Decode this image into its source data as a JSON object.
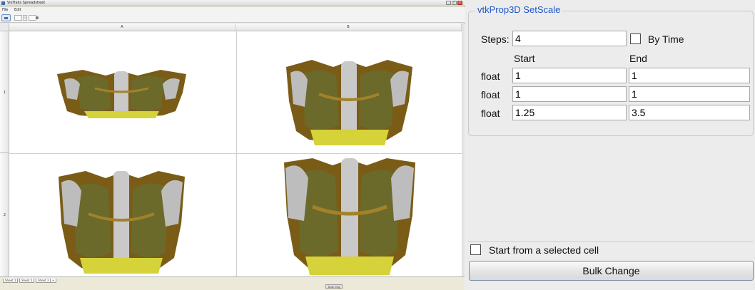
{
  "spreadsheet": {
    "window_title": "VisTrails Spreadsheet",
    "menu": [
      "File",
      "Edit"
    ],
    "toolbar": {
      "counter": "1"
    },
    "columns": [
      "A",
      "B"
    ],
    "rows": [
      "1",
      "2"
    ],
    "cells": [
      {
        "id": "A1",
        "content": "volume rendering of chest CT",
        "scale": 1.25
      },
      {
        "id": "B1",
        "content": "volume rendering of chest CT",
        "scale": 2.0
      },
      {
        "id": "A2",
        "content": "volume rendering of chest CT",
        "scale": 2.75
      },
      {
        "id": "B2",
        "content": "volume rendering of chest CT",
        "scale": 3.5
      }
    ],
    "sheet_tabs": [
      "Sheet 1",
      "Sheet 2",
      "Sheet 3",
      "+"
    ],
    "status_label": "Bulk Chg"
  },
  "panel": {
    "group_title": "vtkProp3D SetScale",
    "steps_label": "Steps:",
    "steps_value": "4",
    "by_time_label": "By Time",
    "by_time_checked": false,
    "start_header": "Start",
    "end_header": "End",
    "rows": [
      {
        "type": "float",
        "start": "1",
        "end": "1"
      },
      {
        "type": "float",
        "start": "1",
        "end": "1"
      },
      {
        "type": "float",
        "start": "1.25",
        "end": "3.5"
      }
    ],
    "start_selected_label": "Start from a selected cell",
    "start_selected_checked": false,
    "bulk_button": "Bulk Change"
  },
  "colors": {
    "group_title": "#1f58c9",
    "panel_bg": "#ececec",
    "skin": "#8b6b1e",
    "bone": "#c7c7c7"
  }
}
